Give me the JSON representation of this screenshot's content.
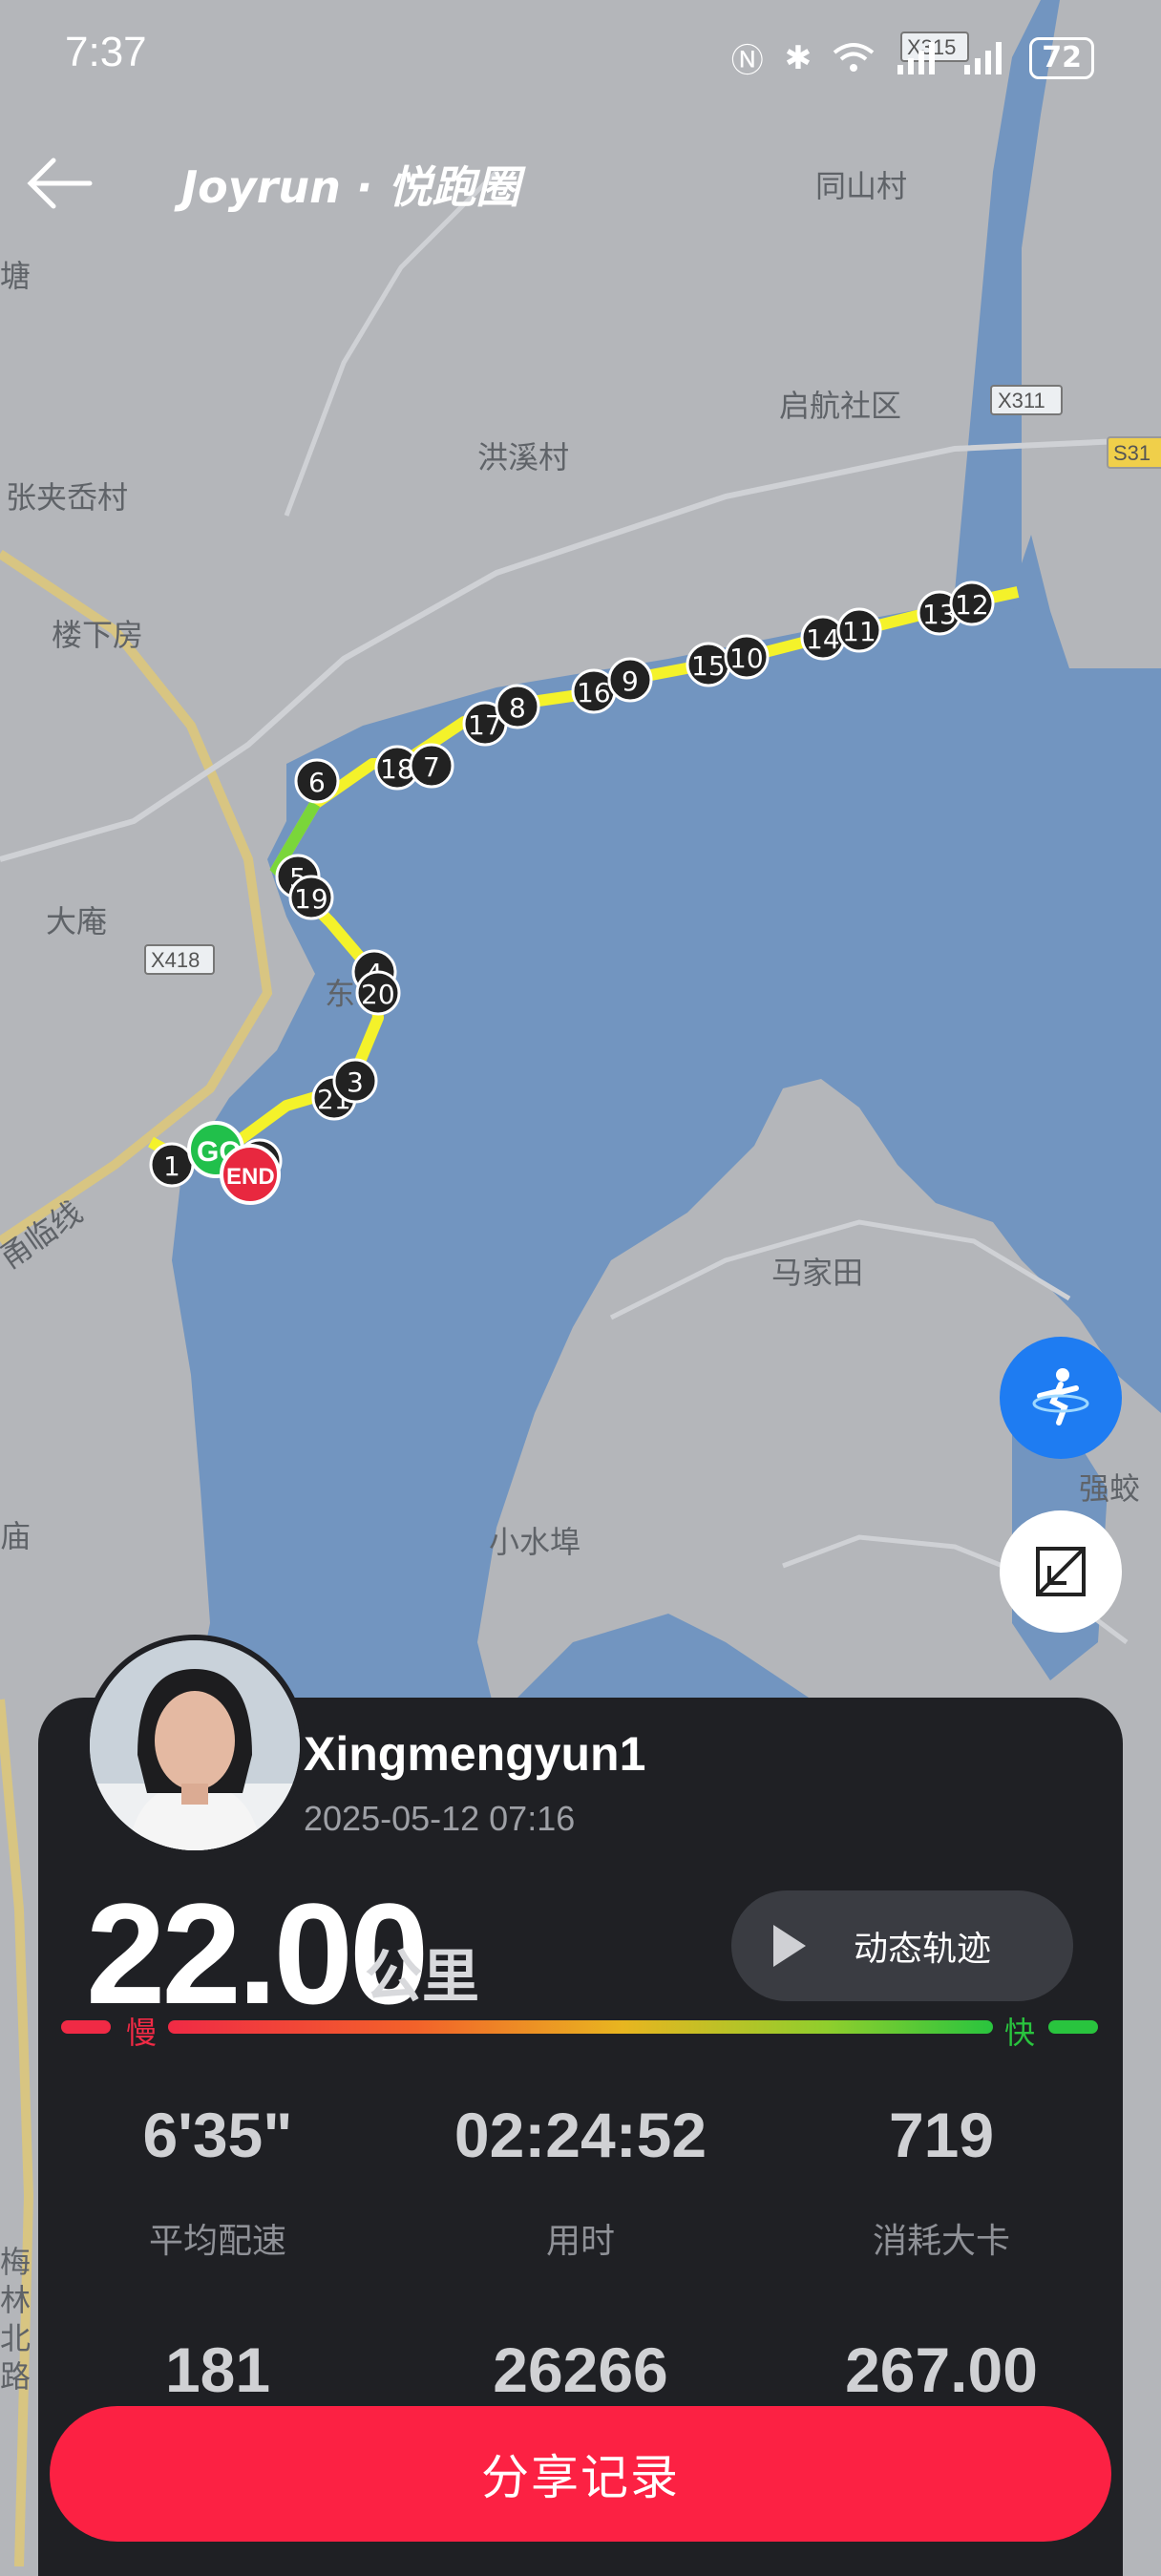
{
  "status_bar": {
    "time": "7:37",
    "battery": "72"
  },
  "header": {
    "logo": "Joyrun · 悦跑圈"
  },
  "map": {
    "places": [
      "同山村",
      "启航社区",
      "洪溪村",
      "张夹岙村",
      "楼下房",
      "大庵",
      "马家田",
      "小水埠",
      "强蛟",
      "甬临线",
      "东",
      "梅林北路",
      "庙",
      "塘"
    ],
    "road_labels": [
      "X315",
      "X311",
      "S31",
      "X418",
      "S3"
    ],
    "markers": [
      "1",
      "2",
      "3",
      "4",
      "5",
      "6",
      "7",
      "8",
      "9",
      "10",
      "11",
      "12",
      "13",
      "14",
      "15",
      "16",
      "17",
      "18",
      "19",
      "20",
      "21"
    ],
    "start_label": "GO",
    "end_label": "END"
  },
  "record": {
    "username": "Xingmengyun1",
    "datetime": "2025-05-12 07:16",
    "distance": "22.00",
    "distance_unit": "公里",
    "replay_label": "动态轨迹",
    "slow_label": "慢",
    "fast_label": "快",
    "stats": [
      {
        "value": "6'35\"",
        "label": "平均配速"
      },
      {
        "value": "02:24:52",
        "label": "用时"
      },
      {
        "value": "719",
        "label": "消耗大卡"
      },
      {
        "value": "181",
        "label": ""
      },
      {
        "value": "26266",
        "label": ""
      },
      {
        "value": "267.00",
        "label": ""
      }
    ],
    "share_label": "分享记录"
  },
  "colors": {
    "water": "#7295c0",
    "land": "#b4b6ba",
    "route": "#f4f22a",
    "accent": "#fc2143",
    "fab_blue": "#1e7cf2",
    "card": "#1f2024"
  }
}
